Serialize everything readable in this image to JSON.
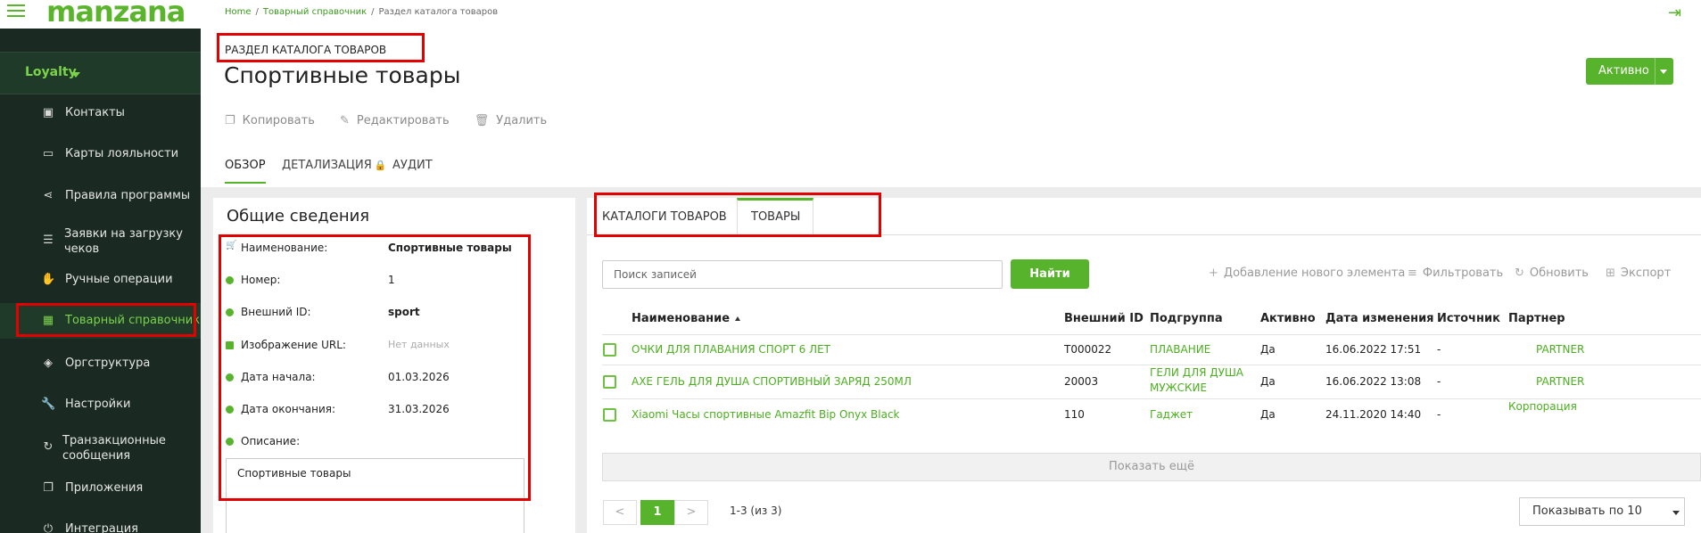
{
  "app": {
    "logo": "manzana"
  },
  "breadcrumb": {
    "items": [
      "Home",
      "Товарный справочник",
      "Раздел каталога товаров"
    ]
  },
  "sidebar": {
    "group": "Loyalty",
    "items": [
      {
        "label": "Контакты",
        "icon": "contact-card-icon"
      },
      {
        "label": "Карты лояльности",
        "icon": "credit-card-icon"
      },
      {
        "label": "Правила программы",
        "icon": "share-nodes-icon"
      },
      {
        "label": "Заявки на загрузку чеков",
        "icon": "document-list-icon"
      },
      {
        "label": "Ручные операции",
        "icon": "hand-icon"
      },
      {
        "label": "Товарный справочник",
        "icon": "grid-icon"
      },
      {
        "label": "Оргструктура",
        "icon": "layers-icon"
      },
      {
        "label": "Настройки",
        "icon": "wrench-icon"
      },
      {
        "label": "Транзакционные сообщения",
        "icon": "refresh-icon"
      },
      {
        "label": "Приложения",
        "icon": "copy-icon"
      },
      {
        "label": "Интеграция",
        "icon": "plug-icon"
      }
    ]
  },
  "header": {
    "section_label": "РАЗДЕЛ КАТАЛОГА ТОВАРОВ",
    "title": "Спортивные товары",
    "status_button": "Активно",
    "actions": {
      "copy": "Копировать",
      "edit": "Редактировать",
      "delete": "Удалить"
    },
    "tabs": {
      "overview": "ОБЗОР",
      "details": "ДЕТАЛИЗАЦИЯ",
      "audit": "АУДИТ"
    }
  },
  "general": {
    "title": "Общие сведения",
    "fields": [
      {
        "label": "Наименование:",
        "value": "Спортивные товары"
      },
      {
        "label": "Номер:",
        "value": "1"
      },
      {
        "label": "Внешний ID:",
        "value": "sport"
      },
      {
        "label": "Изображение URL:",
        "value": "Нет данных"
      },
      {
        "label": "Дата начала:",
        "value": "01.03.2026"
      },
      {
        "label": "Дата окончания:",
        "value": "31.03.2026"
      },
      {
        "label": "Описание:",
        "value": ""
      }
    ],
    "description": "Спортивные товары"
  },
  "right": {
    "tabs": {
      "catalogs": "КАТАЛОГИ ТОВАРОВ",
      "products": "ТОВАРЫ"
    },
    "search": {
      "placeholder": "Поиск записей",
      "button": "Найти"
    },
    "toolbar": {
      "add": "Добавление нового элемента",
      "filter": "Фильтровать",
      "refresh": "Обновить",
      "export": "Экспорт"
    },
    "columns": {
      "name": "Наименование",
      "ext_id": "Внешний ID",
      "subgroup": "Подгруппа",
      "active": "Активно",
      "date": "Дата изменения",
      "source": "Источник",
      "partner": "Партнер"
    },
    "rows": [
      {
        "name": "ОЧКИ ДЛЯ ПЛАВАНИЯ СПОРТ 6 ЛЕТ",
        "ext_id": "T000022",
        "subgroup": "ПЛАВАНИЕ",
        "active": "Да",
        "date": "16.06.2022 17:51",
        "source": "-",
        "partner": "PARTNER"
      },
      {
        "name": "AXE ГЕЛЬ ДЛЯ ДУША СПОРТИВНЫЙ ЗАРЯД 250МЛ",
        "ext_id": "20003",
        "subgroup": "ГЕЛИ ДЛЯ ДУША МУЖСКИЕ",
        "active": "Да",
        "date": "16.06.2022 13:08",
        "source": "-",
        "partner": "PARTNER"
      },
      {
        "name": "Xiaomi Часы спортивные Amazfit Bip Onyx Black",
        "ext_id": "110",
        "subgroup": "Гаджет",
        "active": "Да",
        "date": "24.11.2020 14:40",
        "source": "-",
        "partner": "Корпорация"
      }
    ],
    "show_more": "Показать ещё",
    "pager": {
      "prev": "<",
      "current": "1",
      "next": ">",
      "info": "1-3 (из 3)",
      "per_page": "Показывать по 10"
    }
  }
}
